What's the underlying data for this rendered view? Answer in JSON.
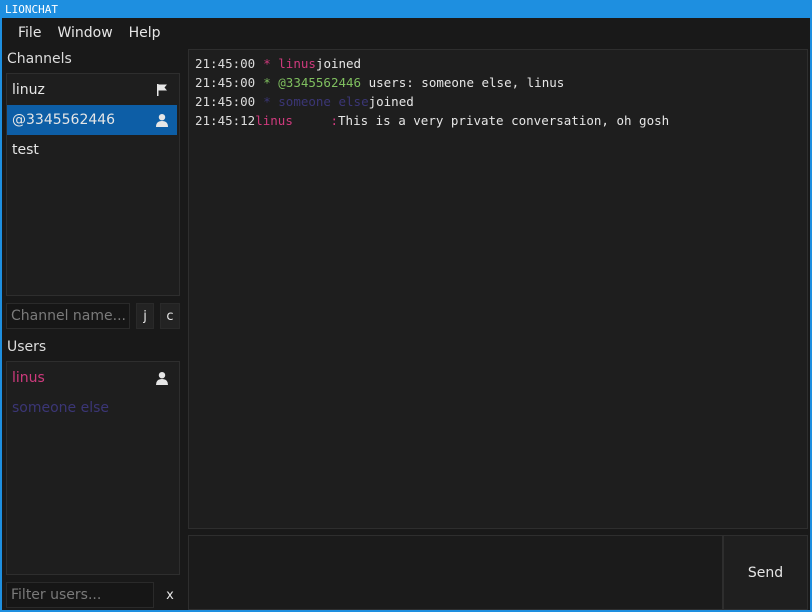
{
  "window": {
    "title": "LIONCHAT"
  },
  "menu": [
    "File",
    "Window",
    "Help"
  ],
  "channels": {
    "label": "Channels",
    "items": [
      {
        "name": "linuz",
        "icon": "flag-icon"
      },
      {
        "name": "@3345562446",
        "icon": "user-icon"
      },
      {
        "name": "test",
        "icon": ""
      }
    ],
    "name_input_placeholder": "Channel name...",
    "join_label": "j",
    "create_label": "c"
  },
  "users": {
    "label": "Users",
    "items": [
      {
        "name": "linus",
        "color": "#cf3a7d",
        "icon": "user-icon"
      },
      {
        "name": "someone else",
        "color": "#3b3676",
        "icon": ""
      }
    ],
    "filter_placeholder": "Filter users...",
    "clear_label": "x"
  },
  "messages": [
    {
      "time": "21:45:00",
      "prefix": "*",
      "prefix_color": "#cf3a7d",
      "nick": "linus",
      "nick_color": "#cf3a7d",
      "text": "joined"
    },
    {
      "time": "21:45:00",
      "prefix": "*",
      "prefix_color": "#7fbf5f",
      "nick": "@3345562446",
      "nick_color": "#7fbf5f",
      "text": "users: someone else, linus"
    },
    {
      "time": "21:45:00",
      "prefix": "*",
      "prefix_color": "#3b3676",
      "nick": "someone else",
      "nick_color": "#3b3676",
      "text": "joined"
    },
    {
      "time": "21:45:12",
      "nick": "linus     ",
      "nick_color": "#cf3a7d",
      "separator": ":",
      "text": "This is a very private conversation, oh gosh"
    }
  ],
  "compose": {
    "send_label": "Send"
  },
  "colors": {
    "accent": "#1e8fe0",
    "selection": "#0d5ea6",
    "background": "#191919"
  }
}
